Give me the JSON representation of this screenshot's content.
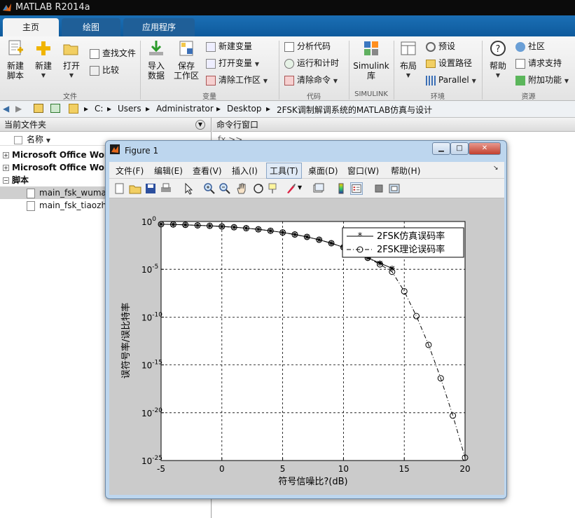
{
  "app": {
    "title": "MATLAB R2014a"
  },
  "tabs": [
    {
      "label": "主页"
    },
    {
      "label": "绘图"
    },
    {
      "label": "应用程序"
    }
  ],
  "ribbon": {
    "new_script": "新建\n脚本",
    "new": "新建",
    "open": "打开",
    "find_files": "查找文件",
    "compare": "比较",
    "import": "导入\n数据",
    "save_workspace": "保存\n工作区",
    "new_variable": "新建变量",
    "open_variable": "打开变量",
    "clear_workspace": "清除工作区",
    "analyze_code": "分析代码",
    "run_and_time": "运行和计时",
    "clear_commands": "清除命令",
    "simulink": "Simulink\n库",
    "layout": "布局",
    "preferences": "预设",
    "set_path": "设置路径",
    "parallel": "Parallel",
    "help": "帮助",
    "community": "社区",
    "request_support": "请求支持",
    "add_ons": "附加功能",
    "groups": {
      "file": "文件",
      "variable": "变量",
      "code": "代码",
      "simulink": "SIMULINK",
      "environment": "环境",
      "resources": "资源"
    }
  },
  "address": {
    "path": [
      "C:",
      "Users",
      "Administrator",
      "Desktop",
      "2FSK调制解调系统的MATLAB仿真与设计"
    ]
  },
  "current_folder": {
    "title": "当前文件夹",
    "column": "名称",
    "items": [
      {
        "label": "Microsoft Office Wor"
      },
      {
        "label": "Microsoft Office Wor"
      },
      {
        "label": "脚本"
      },
      {
        "label": "main_fsk_wumal"
      },
      {
        "label": "main_fsk_tiaozhi"
      }
    ]
  },
  "command_window": {
    "title": "命令行窗口",
    "prompt": "fx >>"
  },
  "figure": {
    "title": "Figure 1",
    "menu": [
      "文件(F)",
      "编辑(E)",
      "查看(V)",
      "插入(I)",
      "工具(T)",
      "桌面(D)",
      "窗口(W)",
      "帮助(H)"
    ],
    "active_menu": "工具(T)"
  },
  "chart_data": {
    "type": "line",
    "xlabel": "符号信噪比?(dB)",
    "ylabel": "误符号率/误比特率",
    "xlim": [
      -5,
      20
    ],
    "ylim_log10": [
      -25,
      0
    ],
    "y_scale": "log",
    "grid": true,
    "legend_position": "top-right",
    "x_ticks": [
      -5,
      0,
      5,
      10,
      15,
      20
    ],
    "y_ticks": [
      "10^0",
      "10^-5",
      "10^-10",
      "10^-15",
      "10^-20",
      "10^-25"
    ],
    "series": [
      {
        "name": "2FSK仿真误码率",
        "marker": "*",
        "line": "solid",
        "x": [
          -5,
          -4,
          -3,
          -2,
          -1,
          0,
          1,
          2,
          3,
          4,
          5,
          6,
          7,
          8,
          9,
          10,
          11,
          12,
          13,
          14
        ],
        "log10_y": [
          -0.28,
          -0.31,
          -0.35,
          -0.4,
          -0.45,
          -0.52,
          -0.6,
          -0.7,
          -0.82,
          -0.97,
          -1.15,
          -1.36,
          -1.61,
          -1.91,
          -2.27,
          -2.7,
          -3.2,
          -3.8,
          -4.35,
          -4.9
        ]
      },
      {
        "name": "2FSK理论误码率",
        "marker": "o",
        "line": "dashdot",
        "x": [
          -5,
          -4,
          -3,
          -2,
          -1,
          0,
          1,
          2,
          3,
          4,
          5,
          6,
          7,
          8,
          9,
          10,
          11,
          12,
          13,
          14,
          15,
          16,
          17,
          18,
          19,
          20
        ],
        "log10_y": [
          -0.28,
          -0.31,
          -0.35,
          -0.4,
          -0.45,
          -0.52,
          -0.6,
          -0.7,
          -0.82,
          -0.97,
          -1.15,
          -1.36,
          -1.61,
          -1.91,
          -2.27,
          -2.7,
          -3.2,
          -3.8,
          -4.48,
          -5.26,
          -7.3,
          -9.9,
          -12.9,
          -16.4,
          -20.3,
          -24.7
        ]
      }
    ]
  }
}
